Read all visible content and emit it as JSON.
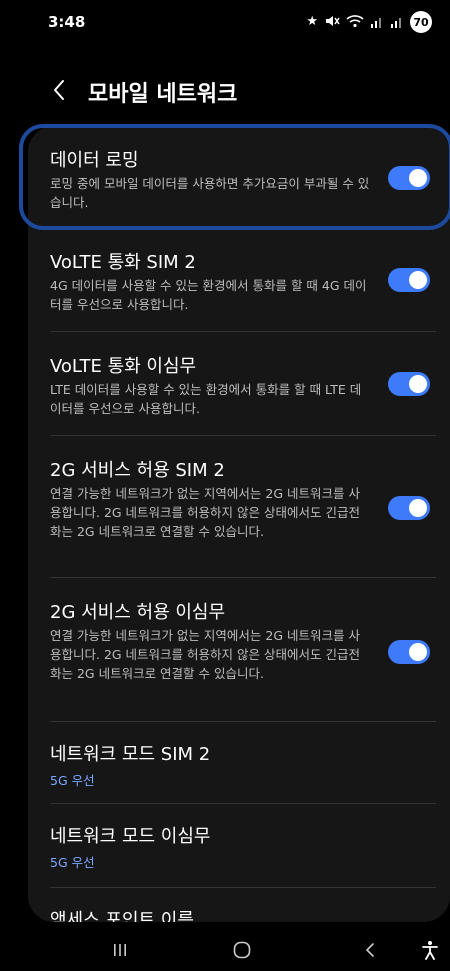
{
  "status_bar": {
    "time": "3:48",
    "battery": "70",
    "icons": [
      "star-icon",
      "mute-icon",
      "wifi-icon",
      "signal-icon",
      "signal-icon"
    ]
  },
  "header": {
    "title": "모바일 네트워크",
    "back_icon": "chevron-left-icon"
  },
  "settings": [
    {
      "title": "데이터 로밍",
      "description": "로밍 중에 모바일 데이터를 사용하면 추가요금이 부과될 수 있습니다.",
      "toggle": true
    },
    {
      "title": "VoLTE 통화 SIM 2",
      "description": "4G 데이터를 사용할 수 있는 환경에서 통화를 할 때 4G 데이터를 우선으로 사용합니다.",
      "toggle": true
    },
    {
      "title": "VoLTE 통화 이심무",
      "description": "LTE 데이터를 사용할 수 있는 환경에서 통화를 할 때 LTE 데이터를 우선으로 사용합니다.",
      "toggle": true
    },
    {
      "title": "2G 서비스 허용 SIM 2",
      "description": "연결 가능한 네트워크가 없는 지역에서는 2G 네트워크를 사용합니다. 2G 네트워크를 허용하지 않은 상태에서도 긴급전화는 2G 네트워크로 연결할 수 있습니다.",
      "toggle": true
    },
    {
      "title": "2G 서비스 허용 이심무",
      "description": "연결 가능한 네트워크가 없는 지역에서는 2G 네트워크를 사용합니다. 2G 네트워크를 허용하지 않은 상태에서도 긴급전화는 2G 네트워크로 연결할 수 있습니다.",
      "toggle": true
    },
    {
      "title": "네트워크 모드 SIM 2",
      "value": "5G 우선"
    },
    {
      "title": "네트워크 모드 이심무",
      "value": "5G 우선"
    },
    {
      "title": "액세스 포인트 이름"
    }
  ],
  "nav_bar": {
    "recents_icon": "recents-icon",
    "home_icon": "home-icon",
    "back_icon": "back-icon",
    "accessibility_icon": "accessibility-icon"
  },
  "colors": {
    "background": "#000000",
    "card": "#161616",
    "accent": "#3e7bfa",
    "value_text": "#7aa7ff",
    "highlight": "#1d4a9c"
  }
}
